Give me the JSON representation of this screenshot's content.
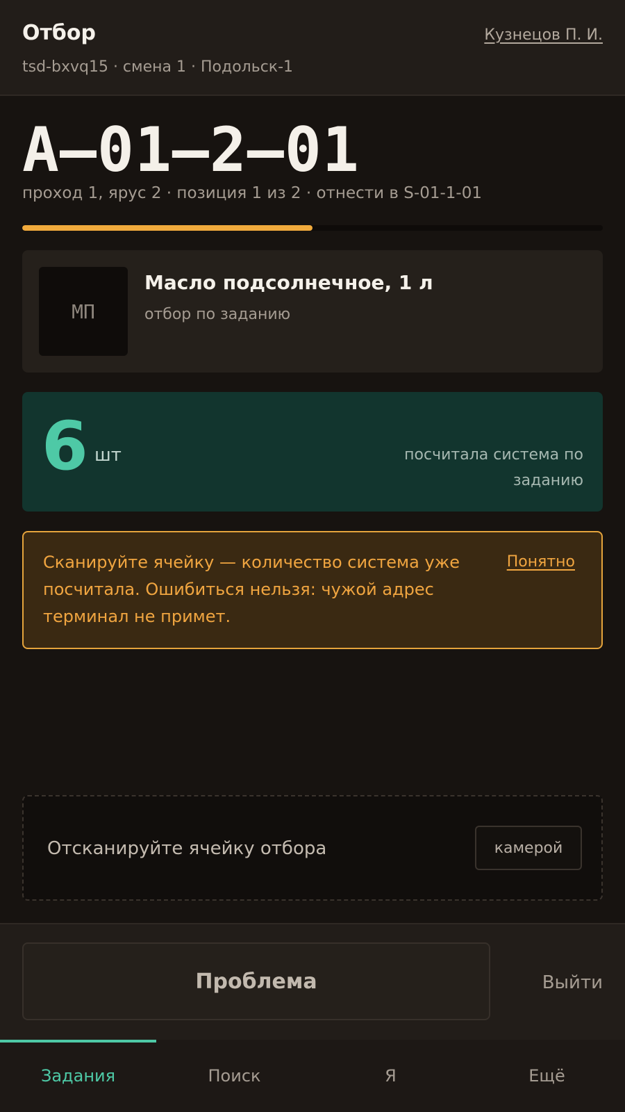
{
  "header": {
    "title": "Отбор",
    "subtitle": "tsd-bxvq15 · смена 1 · Подольск-1",
    "user": "Кузнецов П. И."
  },
  "task": {
    "cell_code": "A–01–2–01",
    "meta": "проход 1, ярус 2 · позиция 1 из 2 · отнести в S-01-1-01",
    "progress_fraction": 0.5
  },
  "product": {
    "thumb_text": "МП",
    "name": "Масло подсолнечное, 1 л",
    "note": "отбор по заданию"
  },
  "quantity": {
    "value": "6",
    "unit": "шт",
    "hint": "посчитала система по заданию"
  },
  "notice": {
    "text": "Сканируйте ячейку — количество система уже посчитала. Ошибиться нельзя: чужой адрес терминал не примет.",
    "ack_label": "Понятно"
  },
  "scan": {
    "label": "Отсканируйте ячейку отбора",
    "camera_label": "камерой"
  },
  "actions": {
    "problem_label": "Проблема",
    "exit_label": "Выйти"
  },
  "tabs": [
    {
      "label": "Задания",
      "active": true
    },
    {
      "label": "Поиск",
      "active": false
    },
    {
      "label": "Я",
      "active": false
    },
    {
      "label": "Ещё",
      "active": false
    }
  ],
  "colors": {
    "accent": "#4ec9a6",
    "warning": "#f0a540",
    "progress": "#f0aa3c"
  }
}
